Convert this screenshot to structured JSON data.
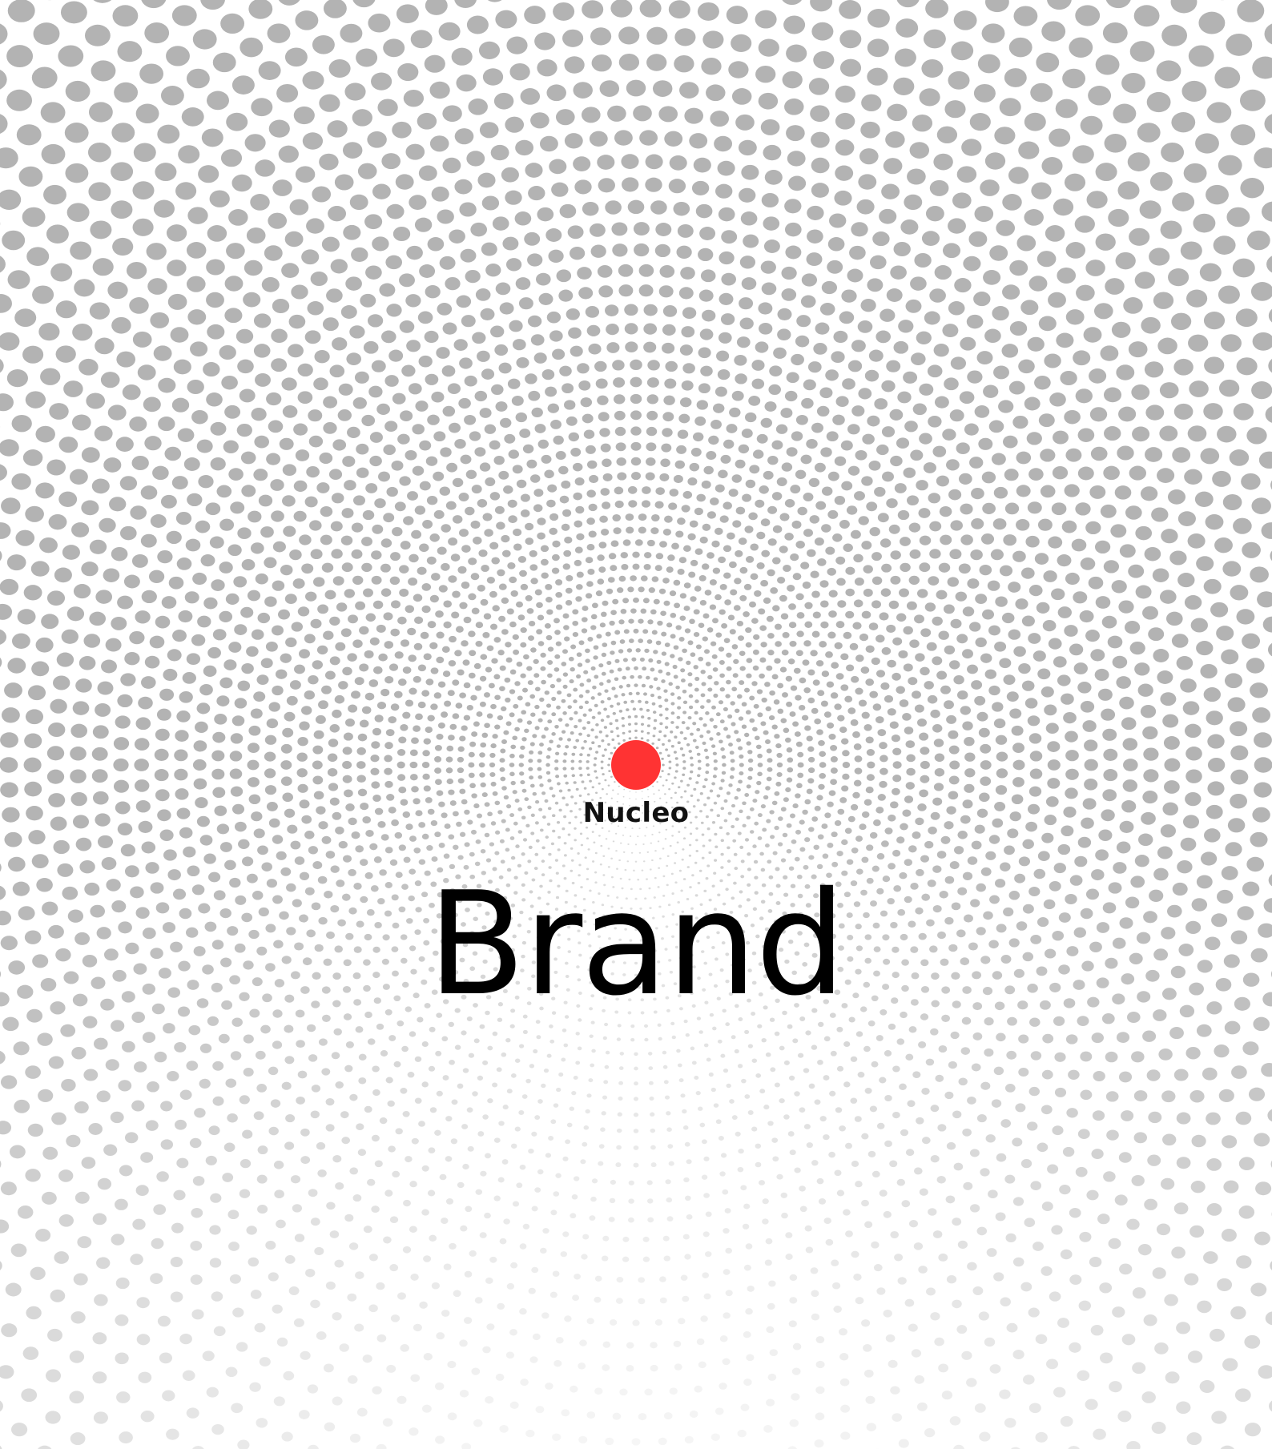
{
  "logo": {
    "brand_name": "Nucleo",
    "icon": "red-circle-icon",
    "accent_color": "#ff3333"
  },
  "headline": "Brand",
  "colors": {
    "background": "#ffffff",
    "dot": "#b3b3b3",
    "text": "#000000"
  }
}
